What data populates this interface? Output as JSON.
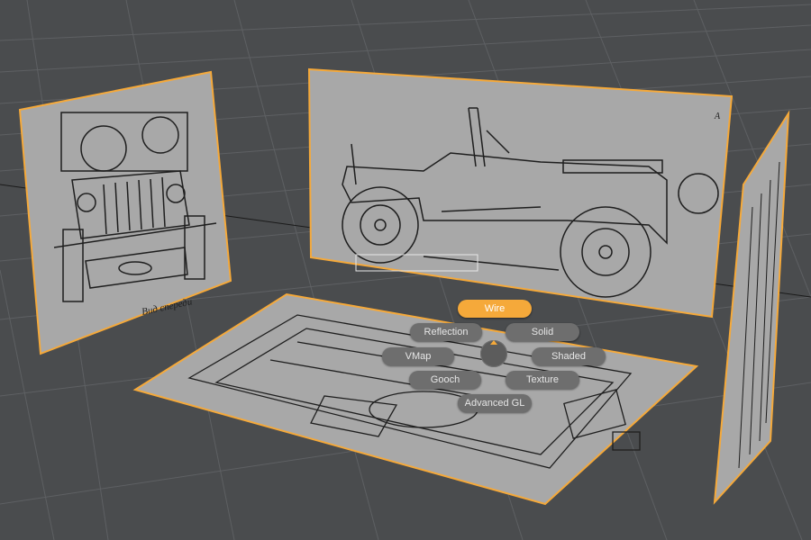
{
  "viewport": {
    "background": "#4a4c4e",
    "grid_color": "#5e6063",
    "selection_color": "#f5a93a",
    "plane_color": "#a8a8a8"
  },
  "image_planes": {
    "front_view_caption": "Вид спереди",
    "side_view_marker": "A"
  },
  "pie_menu": {
    "title": "Wire",
    "items": {
      "reflection": "Reflection",
      "solid": "Solid",
      "vmap": "VMap",
      "shaded": "Shaded",
      "gooch": "Gooch",
      "texture": "Texture",
      "advanced_gl": "Advanced GL"
    },
    "active_item": "Wire"
  }
}
